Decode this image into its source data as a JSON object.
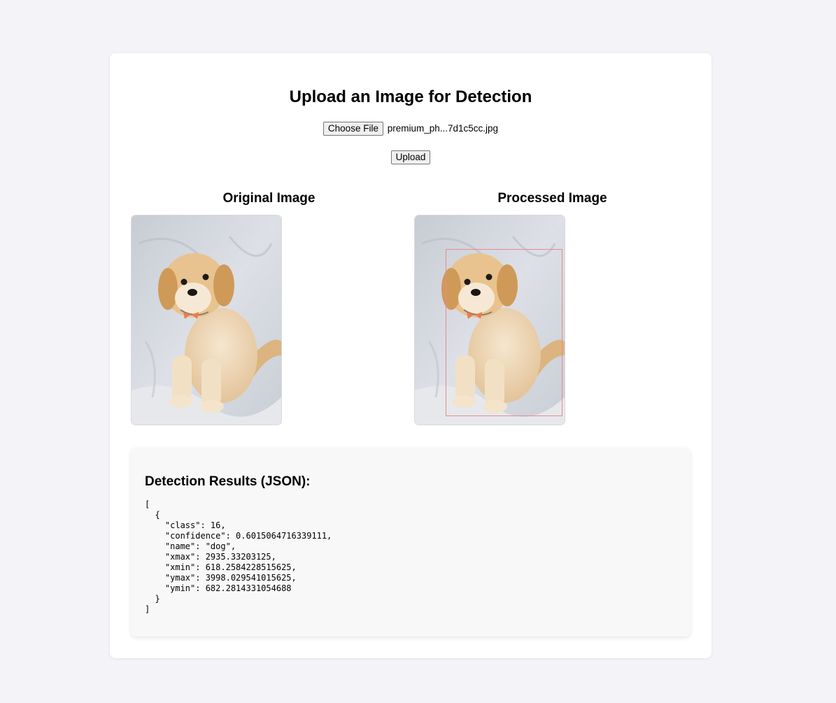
{
  "page": {
    "title": "Upload an Image for Detection",
    "choose_file_label": "Choose File",
    "file_name": "premium_ph...7d1c5cc.jpg",
    "upload_label": "Upload"
  },
  "images": {
    "original_title": "Original Image",
    "processed_title": "Processed Image"
  },
  "results": {
    "title": "Detection Results (JSON):",
    "json_lines": [
      "[",
      "  {",
      "    \"class\": 16,",
      "    \"confidence\": 0.6015064716339111,",
      "    \"name\": \"dog\",",
      "    \"xmax\": 2935.33203125,",
      "    \"xmin\": 618.2584228515625,",
      "    \"ymax\": 3998.029541015625,",
      "    \"ymin\": 682.2814331054688",
      "  }",
      "]"
    ]
  },
  "colors": {
    "page_bg": "#f4f4f8",
    "card_bg": "#ffffff",
    "results_bg": "#f8f8f8",
    "bbox_color": "#e88a8a"
  }
}
